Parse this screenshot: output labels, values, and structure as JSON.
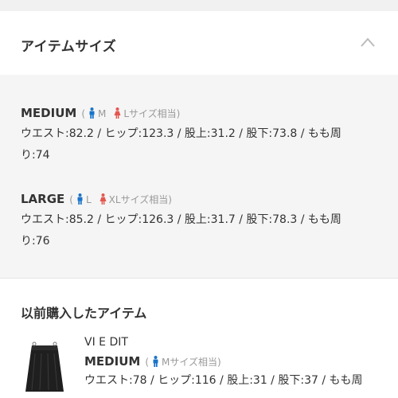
{
  "header": {
    "title": "アイテムサイズ",
    "collapse_icon": "chevron-up-icon"
  },
  "sizes": [
    {
      "name": "MEDIUM",
      "open_paren": "(",
      "male_label": "M",
      "female_label": "Lサイズ相当)",
      "measure_line1": "ウエスト:82.2 / ヒップ:123.3 / 股上:31.2 / 股下:73.8 / もも周",
      "measure_line2": "り:74"
    },
    {
      "name": "LARGE",
      "open_paren": "(",
      "male_label": "L",
      "female_label": "XLサイズ相当)",
      "measure_line1": "ウエスト:85.2 / ヒップ:126.3 / 股上:31.7 / 股下:78.3 / もも周",
      "measure_line2": "り:76"
    }
  ],
  "previous": {
    "title": "以前購入したアイテム",
    "brand": "VI E DIT",
    "size_name": "MEDIUM",
    "open_paren": "(",
    "male_label": "Mサイズ相当)",
    "measure_line1": "ウエスト:78 / ヒップ:116 / 股上:31 / 股下:37 / もも周"
  },
  "colors": {
    "male_icon": "#1a73c9",
    "female_icon": "#e4574f",
    "panel_bg": "#f5f5f5"
  }
}
